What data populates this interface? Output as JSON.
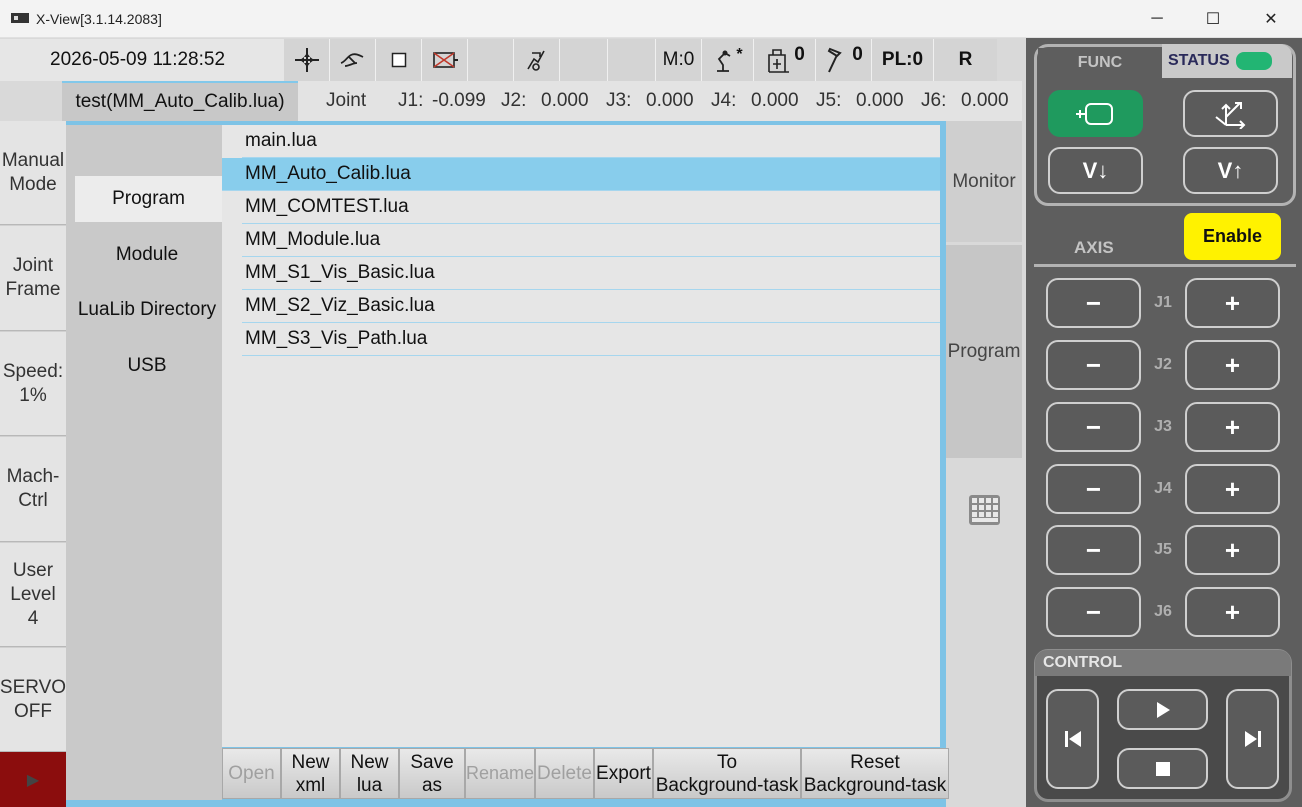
{
  "window": {
    "title": "X-View[3.1.14.2083]",
    "minimize": "─",
    "maximize": "☐",
    "close": "✕"
  },
  "status": {
    "datetime": "2026-05-09 11:28:52",
    "m_value": "M:0",
    "robot_badge": "*",
    "tool_count": "0",
    "hammer_count": "0",
    "pl": "PL:0",
    "r": "R"
  },
  "file_tab": "test(MM_Auto_Calib.lua)",
  "joint": {
    "label": "Joint",
    "values": [
      {
        "name": "J1:",
        "value": "-0.099"
      },
      {
        "name": "J2:",
        "value": "0.000"
      },
      {
        "name": "J3:",
        "value": "0.000"
      },
      {
        "name": "J4:",
        "value": "0.000"
      },
      {
        "name": "J5:",
        "value": "0.000"
      },
      {
        "name": "J6:",
        "value": "0.000"
      }
    ]
  },
  "side_menu": {
    "mode": "Manual\nMode",
    "frame": "Joint\nFrame",
    "speed": "Speed:\n1%",
    "mach": "Mach-\nCtrl",
    "user": "User\nLevel\n4",
    "servo": "SERVO\nOFF",
    "run": "▶"
  },
  "categories": [
    "Program",
    "Module",
    "LuaLib Directory",
    "USB"
  ],
  "files": [
    "main.lua",
    "MM_Auto_Calib.lua",
    "MM_COMTEST.lua",
    "MM_Module.lua",
    "MM_S1_Vis_Basic.lua",
    "MM_S2_Viz_Basic.lua",
    "MM_S3_Vis_Path.lua"
  ],
  "selected_file": "MM_Auto_Calib.lua",
  "buttons": {
    "open": "Open",
    "new_xml": "New\nxml",
    "new_lua": "New\nlua",
    "save_as": "Save as",
    "rename": "Rename",
    "delete": "Delete",
    "export": "Export",
    "to_bg": "To\nBackground-task",
    "reset_bg": "Reset\nBackground-task"
  },
  "right_tabs": {
    "monitor": "Monitor",
    "program": "Program"
  },
  "pendant": {
    "func_label": "FUNC",
    "status_label": "STATUS",
    "v_down": "V↓",
    "v_up": "V↑",
    "axis_label": "AXIS",
    "enable": "Enable",
    "axes": [
      "J1",
      "J2",
      "J3",
      "J4",
      "J5",
      "J6"
    ],
    "minus": "−",
    "plus": "+",
    "control_label": "CONTROL"
  },
  "colors": {
    "accent": "#88cdec",
    "enable": "#fff200",
    "func_active": "#1f9a5e",
    "status_led": "#22b573",
    "run_button": "#8b0d0d"
  }
}
